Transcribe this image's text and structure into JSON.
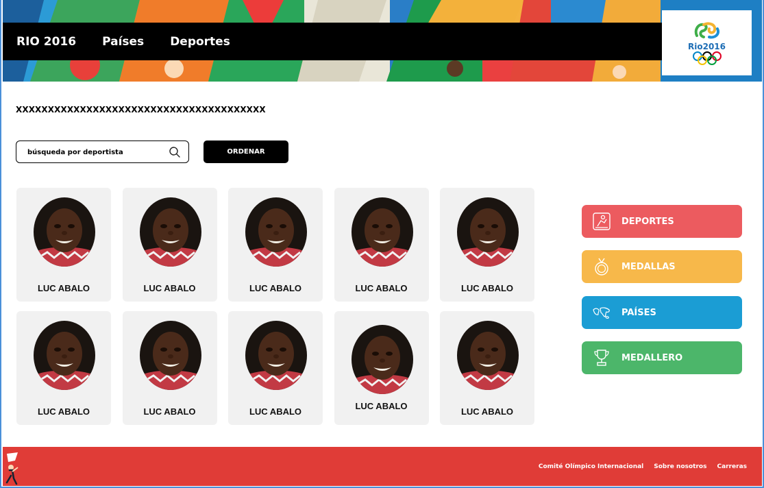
{
  "header": {
    "nav": [
      "RIO 2016",
      "Países",
      "Deportes"
    ],
    "logo_text": "Rio2016"
  },
  "page": {
    "heading": "XXXXXXXXXXXXXXXXXXXXXXXXXXXXXXXXXXXXXXX"
  },
  "search": {
    "placeholder": "búsqueda por deportista",
    "order_label": "ORDENAR"
  },
  "athletes": [
    {
      "name": "LUC ABALO"
    },
    {
      "name": "LUC ABALO"
    },
    {
      "name": "LUC ABALO"
    },
    {
      "name": "LUC ABALO"
    },
    {
      "name": "LUC ABALO"
    },
    {
      "name": "LUC ABALO"
    },
    {
      "name": "LUC ABALO"
    },
    {
      "name": "LUC ABALO"
    },
    {
      "name": "LUC ABALO"
    },
    {
      "name": "LUC ABALO"
    }
  ],
  "side_menu": [
    {
      "label": "DEPORTES",
      "icon": "sports-icon",
      "color": "#ec5b5f"
    },
    {
      "label": "MEDALLAS",
      "icon": "medal-icon",
      "color": "#f7b84a"
    },
    {
      "label": "PAÍSES",
      "icon": "world-map-icon",
      "color": "#1b9dd4"
    },
    {
      "label": "MEDALLERO",
      "icon": "trophy-icon",
      "color": "#4cb66a"
    }
  ],
  "footer": {
    "links": [
      "Comité Olímpico Internacional",
      "Sobre nosotros",
      "Carreras"
    ]
  },
  "colors": {
    "footer": "#e03c37",
    "navbar": "#000000",
    "card_bg": "#f1f1f1"
  }
}
